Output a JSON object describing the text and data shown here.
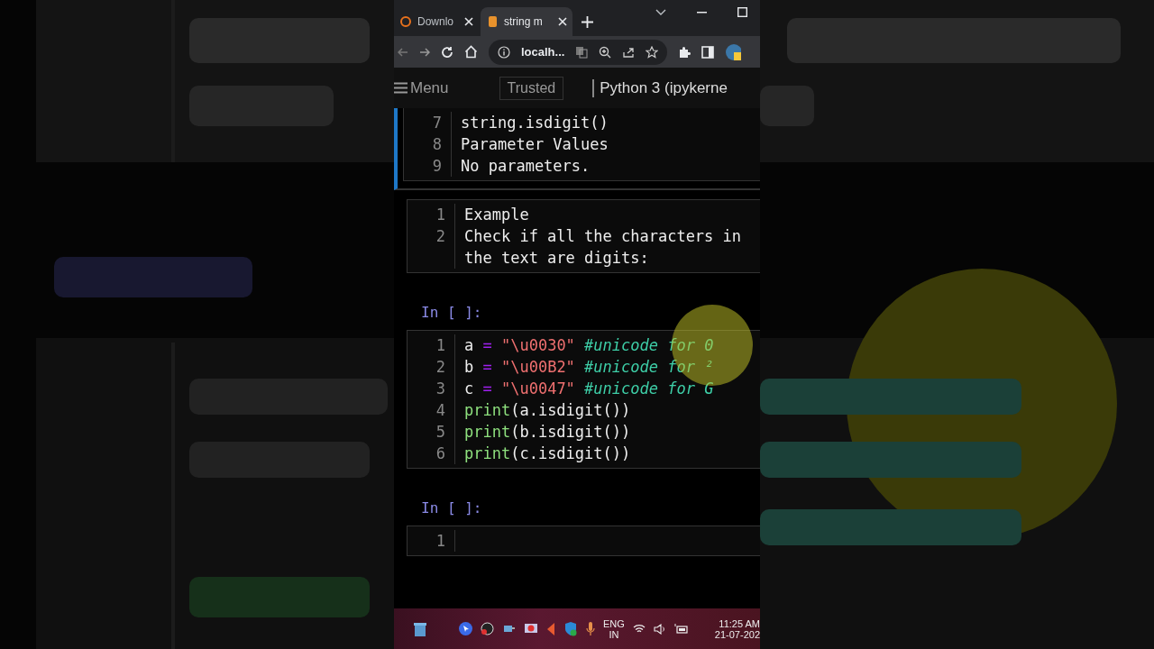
{
  "browser": {
    "tabs": [
      {
        "title": "Downlo",
        "selected": false
      },
      {
        "title": "string m",
        "selected": true
      }
    ],
    "address": "localh..."
  },
  "notebook_header": {
    "menu": "Menu",
    "trusted": "Trusted",
    "kernel": "Python 3 (ipykerne"
  },
  "cells": [
    {
      "kind": "markdown",
      "selected": true,
      "lines": [
        {
          "number": "7",
          "tokens": [
            {
              "text": "string.isdigit()",
              "kind": "plain"
            }
          ]
        },
        {
          "number": "8",
          "tokens": [
            {
              "text": "Parameter Values",
              "kind": "plain"
            }
          ]
        },
        {
          "number": "9",
          "tokens": [
            {
              "text": "No parameters.",
              "kind": "plain"
            }
          ]
        }
      ]
    },
    {
      "kind": "markdown",
      "selected": false,
      "lines": [
        {
          "number": "1",
          "tokens": [
            {
              "text": "Example",
              "kind": "plain"
            }
          ]
        },
        {
          "number": "2",
          "tokens": [
            {
              "text": "Check if all the characters in the text are digits:",
              "kind": "plain"
            }
          ]
        }
      ]
    },
    {
      "kind": "code",
      "selected": false,
      "prompt": "In [ ]:",
      "lines": [
        {
          "number": "1",
          "tokens": [
            {
              "text": "a ",
              "kind": "plain"
            },
            {
              "text": "=",
              "kind": "op"
            },
            {
              "text": " \"\\u0030\" ",
              "kind": "string"
            },
            {
              "text": "#unicode for 0",
              "kind": "comment"
            }
          ]
        },
        {
          "number": "2",
          "tokens": [
            {
              "text": "b ",
              "kind": "plain"
            },
            {
              "text": "=",
              "kind": "op"
            },
            {
              "text": " \"\\u00B2\" ",
              "kind": "string"
            },
            {
              "text": "#unicode for ²",
              "kind": "comment"
            }
          ]
        },
        {
          "number": "3",
          "tokens": [
            {
              "text": "c ",
              "kind": "plain"
            },
            {
              "text": "=",
              "kind": "op"
            },
            {
              "text": " \"\\u0047\" ",
              "kind": "string"
            },
            {
              "text": "#unicode for G",
              "kind": "comment"
            }
          ]
        },
        {
          "number": "4",
          "tokens": [
            {
              "text": "print",
              "kind": "builtin"
            },
            {
              "text": "(a.isdigit())",
              "kind": "plain"
            }
          ]
        },
        {
          "number": "5",
          "tokens": [
            {
              "text": "print",
              "kind": "builtin"
            },
            {
              "text": "(b.isdigit())",
              "kind": "plain"
            }
          ]
        },
        {
          "number": "6",
          "tokens": [
            {
              "text": "print",
              "kind": "builtin"
            },
            {
              "text": "(c.isdigit())",
              "kind": "plain"
            }
          ]
        }
      ]
    },
    {
      "kind": "code",
      "selected": false,
      "prompt": "In [ ]:",
      "lines": [
        {
          "number": "1"
        }
      ]
    }
  ],
  "taskbar": {
    "language": "ENG",
    "region": "IN",
    "time": "11:25 AM",
    "date": "21-07-202"
  }
}
